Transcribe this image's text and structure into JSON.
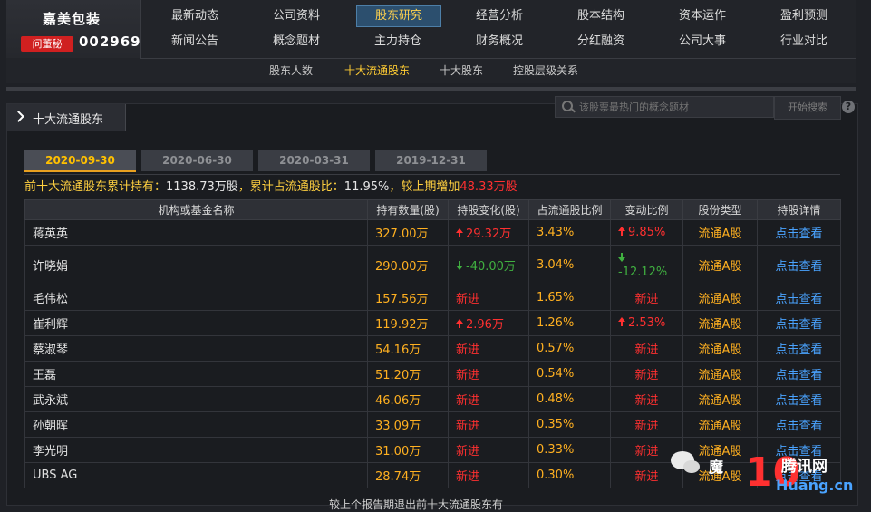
{
  "header": {
    "company_name": "嘉美包装",
    "ask_badge": "问董秘",
    "stock_code": "002969",
    "nav_row1": [
      "最新动态",
      "公司资料",
      "股东研究",
      "经营分析",
      "股本结构",
      "资本运作",
      "盈利预测"
    ],
    "nav_row2": [
      "新闻公告",
      "概念题材",
      "主力持仓",
      "财务概况",
      "分红融资",
      "公司大事",
      "行业对比"
    ],
    "nav_active": "股东研究",
    "subnav": [
      "股东人数",
      "十大流通股东",
      "十大股东",
      "控股层级关系"
    ],
    "subnav_active": "十大流通股东"
  },
  "search": {
    "placeholder": "该股票最热门的概念题材",
    "button": "开始搜索",
    "help": "?"
  },
  "section": {
    "title": "十大流通股东",
    "tabs": [
      "2020-09-30",
      "2020-06-30",
      "2020-03-31",
      "2019-12-31"
    ],
    "active_tab": "2020-09-30"
  },
  "summary": {
    "prefix": "前十大流通股东累计持有：",
    "total": "1138.73万股",
    "mid": "，累计占流通股比：",
    "ratio": "11.95%",
    "suffix": "，较上期增加",
    "increase": "48.33万股"
  },
  "table": {
    "columns": [
      "机构或基金名称",
      "持有数量(股)",
      "持股变化(股)",
      "占流通股比例",
      "变动比例",
      "股份类型",
      "持股详情"
    ],
    "rows": [
      {
        "name": "蒋英英",
        "shares": "327.00万",
        "change": "29.32万",
        "change_dir": "up",
        "pct": "3.43%",
        "var": "9.85%",
        "var_dir": "up",
        "type": "流通A股",
        "detail": "点击查看"
      },
      {
        "name": "许晓娟",
        "shares": "290.00万",
        "change": "-40.00万",
        "change_dir": "down",
        "pct": "3.04%",
        "var": "-12.12%",
        "var_dir": "down",
        "type": "流通A股",
        "detail": "点击查看"
      },
      {
        "name": "毛伟松",
        "shares": "157.56万",
        "change": "新进",
        "change_dir": "new",
        "pct": "1.65%",
        "var": "新进",
        "var_dir": "new",
        "type": "流通A股",
        "detail": "点击查看"
      },
      {
        "name": "崔利辉",
        "shares": "119.92万",
        "change": "2.96万",
        "change_dir": "up",
        "pct": "1.26%",
        "var": "2.53%",
        "var_dir": "up",
        "type": "流通A股",
        "detail": "点击查看"
      },
      {
        "name": "蔡淑琴",
        "shares": "54.16万",
        "change": "新进",
        "change_dir": "new",
        "pct": "0.57%",
        "var": "新进",
        "var_dir": "new",
        "type": "流通A股",
        "detail": "点击查看"
      },
      {
        "name": "王磊",
        "shares": "51.20万",
        "change": "新进",
        "change_dir": "new",
        "pct": "0.54%",
        "var": "新进",
        "var_dir": "new",
        "type": "流通A股",
        "detail": "点击查看"
      },
      {
        "name": "武永斌",
        "shares": "46.06万",
        "change": "新进",
        "change_dir": "new",
        "pct": "0.48%",
        "var": "新进",
        "var_dir": "new",
        "type": "流通A股",
        "detail": "点击查看"
      },
      {
        "name": "孙朝晖",
        "shares": "33.09万",
        "change": "新进",
        "change_dir": "new",
        "pct": "0.35%",
        "var": "新进",
        "var_dir": "new",
        "type": "流通A股",
        "detail": "点击查看"
      },
      {
        "name": "李光明",
        "shares": "31.00万",
        "change": "新进",
        "change_dir": "new",
        "pct": "0.33%",
        "var": "新进",
        "var_dir": "new",
        "type": "流通A股",
        "detail": "点击查看"
      },
      {
        "name": "UBS AG",
        "shares": "28.74万",
        "change": "新进",
        "change_dir": "new",
        "pct": "0.30%",
        "var": "新进",
        "var_dir": "new",
        "type": "流通A股",
        "detail": "点击查看"
      }
    ]
  },
  "footer_note": "较上个报告期退出前十大流通股东有",
  "watermark": {
    "text": "魔",
    "logo": "10",
    "site": "腾讯网",
    "domain": "Huang.cn"
  },
  "colors": {
    "page_bg": "#1f2126",
    "accent_yellow": "#ffc000",
    "rise_red": "#ff3030",
    "fall_green": "#40b040",
    "link_blue": "#4aa3ff"
  }
}
